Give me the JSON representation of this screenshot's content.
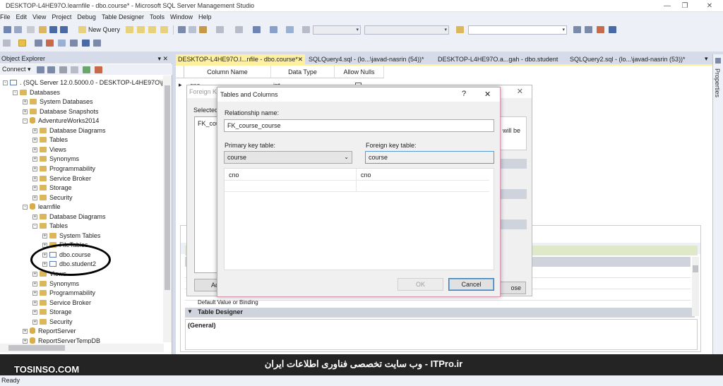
{
  "window": {
    "title": "DESKTOP-L4HE97O.learnfile - dbo.course* - Microsoft SQL Server Management Studio",
    "minimize": "—",
    "restore": "❐",
    "close": "✕"
  },
  "menu": [
    "File",
    "Edit",
    "View",
    "Project",
    "Debug",
    "Table Designer",
    "Tools",
    "Window",
    "Help"
  ],
  "toolbar": {
    "new_query": "New Query"
  },
  "object_explorer": {
    "title": "Object Explorer",
    "pin": "▾ ✕",
    "connect": "Connect ▾",
    "nodes": [
      {
        "label": ". (SQL Server 12.0.5000.0 - DESKTOP-L4HE97O\\java",
        "level": 0,
        "kind": "server",
        "exp": "-"
      },
      {
        "label": "Databases",
        "level": 1,
        "kind": "folder",
        "exp": "-"
      },
      {
        "label": "System Databases",
        "level": 2,
        "kind": "folder",
        "exp": "+"
      },
      {
        "label": "Database Snapshots",
        "level": 2,
        "kind": "folder",
        "exp": "+"
      },
      {
        "label": "AdventureWorks2014",
        "level": 2,
        "kind": "db",
        "exp": "-"
      },
      {
        "label": "Database Diagrams",
        "level": 3,
        "kind": "folder",
        "exp": "+"
      },
      {
        "label": "Tables",
        "level": 3,
        "kind": "folder",
        "exp": "+"
      },
      {
        "label": "Views",
        "level": 3,
        "kind": "folder",
        "exp": "+"
      },
      {
        "label": "Synonyms",
        "level": 3,
        "kind": "folder",
        "exp": "+"
      },
      {
        "label": "Programmability",
        "level": 3,
        "kind": "folder",
        "exp": "+"
      },
      {
        "label": "Service Broker",
        "level": 3,
        "kind": "folder",
        "exp": "+"
      },
      {
        "label": "Storage",
        "level": 3,
        "kind": "folder",
        "exp": "+"
      },
      {
        "label": "Security",
        "level": 3,
        "kind": "folder",
        "exp": "+"
      },
      {
        "label": "learnfile",
        "level": 2,
        "kind": "db",
        "exp": "-"
      },
      {
        "label": "Database Diagrams",
        "level": 3,
        "kind": "folder",
        "exp": "+"
      },
      {
        "label": "Tables",
        "level": 3,
        "kind": "folder",
        "exp": "-"
      },
      {
        "label": "System Tables",
        "level": 4,
        "kind": "folder",
        "exp": "+"
      },
      {
        "label": "FileTables",
        "level": 4,
        "kind": "folder",
        "exp": "+"
      },
      {
        "label": "dbo.course",
        "level": 4,
        "kind": "table",
        "exp": "+"
      },
      {
        "label": "dbo.student2",
        "level": 4,
        "kind": "table",
        "exp": "+"
      },
      {
        "label": "Views",
        "level": 3,
        "kind": "folder",
        "exp": "+"
      },
      {
        "label": "Synonyms",
        "level": 3,
        "kind": "folder",
        "exp": "+"
      },
      {
        "label": "Programmability",
        "level": 3,
        "kind": "folder",
        "exp": "+"
      },
      {
        "label": "Service Broker",
        "level": 3,
        "kind": "folder",
        "exp": "+"
      },
      {
        "label": "Storage",
        "level": 3,
        "kind": "folder",
        "exp": "+"
      },
      {
        "label": "Security",
        "level": 3,
        "kind": "folder",
        "exp": "+"
      },
      {
        "label": "ReportServer",
        "level": 2,
        "kind": "db",
        "exp": "+"
      },
      {
        "label": "ReportServerTempDB",
        "level": 2,
        "kind": "db",
        "exp": "+"
      }
    ]
  },
  "tabs": [
    "DESKTOP-L4HE97O.l...nfile - dbo.course*",
    "SQLQuery4.sql - (lo...\\javad-nasrin (54))*",
    "DESKTOP-L4HE97O.a...gah - dbo.student",
    "SQLQuery2.sql - (lo...\\javad-nasrin (53))*"
  ],
  "tab_close": "✕",
  "properties": "Properties",
  "table_designer": {
    "headers": [
      "Column Name",
      "Data Type",
      "Allow Nulls"
    ],
    "row": {
      "name": "cno",
      "type": "int"
    },
    "section": "Table Designer",
    "general": "(General)",
    "default_value": "Default Value or Binding"
  },
  "fk_dialog": {
    "title": "Foreign Key Relationships",
    "selected": "Selected",
    "item": "FK_cou",
    "add": "Add",
    "close": "Close",
    "note": "will be"
  },
  "tc_dialog": {
    "title": "Tables and Columns",
    "help": "?",
    "close": "✕",
    "relationship_label": "Relationship name:",
    "relationship_name": "FK_course_course",
    "pk_label": "Primary key table:",
    "pk_value": "course",
    "fk_label": "Foreign key table:",
    "fk_value": "course",
    "pk_column": "cno",
    "fk_column": "cno",
    "ok": "OK",
    "cancel": "Cancel"
  },
  "status": "Ready",
  "watermark": "وب سایت تخصصی فناوری اطلاعات ایران - ITPro.ir",
  "logo": "TOSINSO.COM"
}
